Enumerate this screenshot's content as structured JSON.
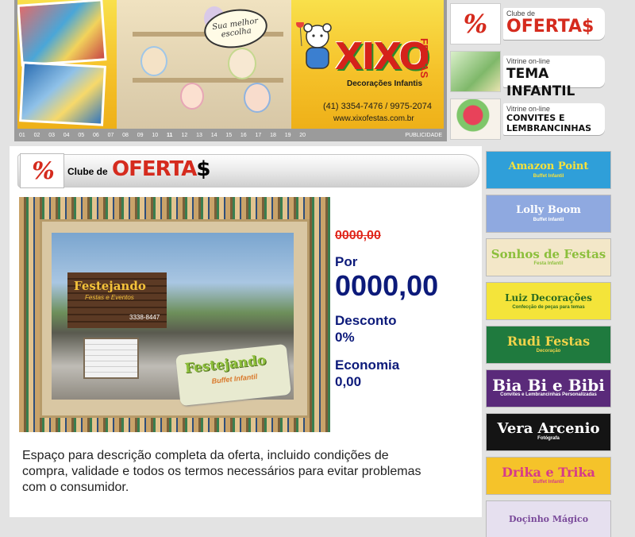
{
  "banner": {
    "speech": "Sua melhor escolha",
    "brand": "XIXO",
    "brand_vertical": "FESTAS",
    "subtitle": "Decorações Infantis",
    "phone": "(41) 3354-7476 / 9975-2074",
    "url": "www.xixofestas.com.br",
    "pages": [
      "01",
      "02",
      "03",
      "04",
      "05",
      "06",
      "07",
      "08",
      "09",
      "10",
      "11",
      "12",
      "13",
      "14",
      "15",
      "16",
      "17",
      "18",
      "19",
      "20"
    ],
    "active_page": "11",
    "publicidade": "PUBLICIDADE"
  },
  "top_links": [
    {
      "small": "Clube de",
      "big": "OFERTA$"
    },
    {
      "small": "Vitrine on-line",
      "big": "TEMA INFANTIL"
    },
    {
      "small": "Vitrine on-line",
      "big": "CONVITES E LEMBRANCINHAS"
    }
  ],
  "panel": {
    "logo": "%",
    "clube_de": "Clube de",
    "ofertas": "OFERTA",
    "ofertas_dollar": "$",
    "image": {
      "sign_title": "Festejando",
      "sign_sub": "Festas e Eventos",
      "sign_phone": "3338-8447",
      "tag_title": "Festejando",
      "tag_sub": "Buffet Infantil"
    },
    "old_price": "0000,00",
    "por_label": "Por",
    "new_price": "0000,00",
    "desconto_label": "Desconto",
    "desconto_value": "0%",
    "economia_label": "Economia",
    "economia_value": "0,00",
    "description": "Espaço para descrição completa da oferta, incluido condições de compra, validade e todos os termos necessários para evitar problemas com o consumidor."
  },
  "sponsors": [
    {
      "name": "Amazon Point",
      "sub": "Buffet Infantil",
      "bg": "#2f9fd9",
      "fg": "#f8e23a"
    },
    {
      "name": "Lolly Boom",
      "sub": "Buffet Infantil",
      "bg": "#8fa9e0",
      "fg": "#ffffff"
    },
    {
      "name": "Sonhos de Festas",
      "sub": "Festa Infantil",
      "bg": "#f3e7c8",
      "fg": "#8cbf3c"
    },
    {
      "name": "Luiz Decorações",
      "sub": "Confecção de peças para temas",
      "bg": "#f4e43a",
      "fg": "#2a6a1f"
    },
    {
      "name": "Rudi Festas",
      "sub": "Decoração",
      "bg": "#1f7a3e",
      "fg": "#f0d34a"
    },
    {
      "name": "Bia Bi e Bibi",
      "sub": "Convites e Lembrancinhas Personalizadas",
      "bg": "#5a2a7a",
      "fg": "#ffffff"
    },
    {
      "name": "Vera Arcenio",
      "sub": "Fotógrafa",
      "bg": "#141414",
      "fg": "#ffffff"
    },
    {
      "name": "Drika e Trika",
      "sub": "Buffet Infantil",
      "bg": "#f5c32a",
      "fg": "#d63a8a"
    },
    {
      "name": "Doçinho Mágico",
      "sub": "",
      "bg": "#e6e0ef",
      "fg": "#7a4a9a"
    }
  ]
}
